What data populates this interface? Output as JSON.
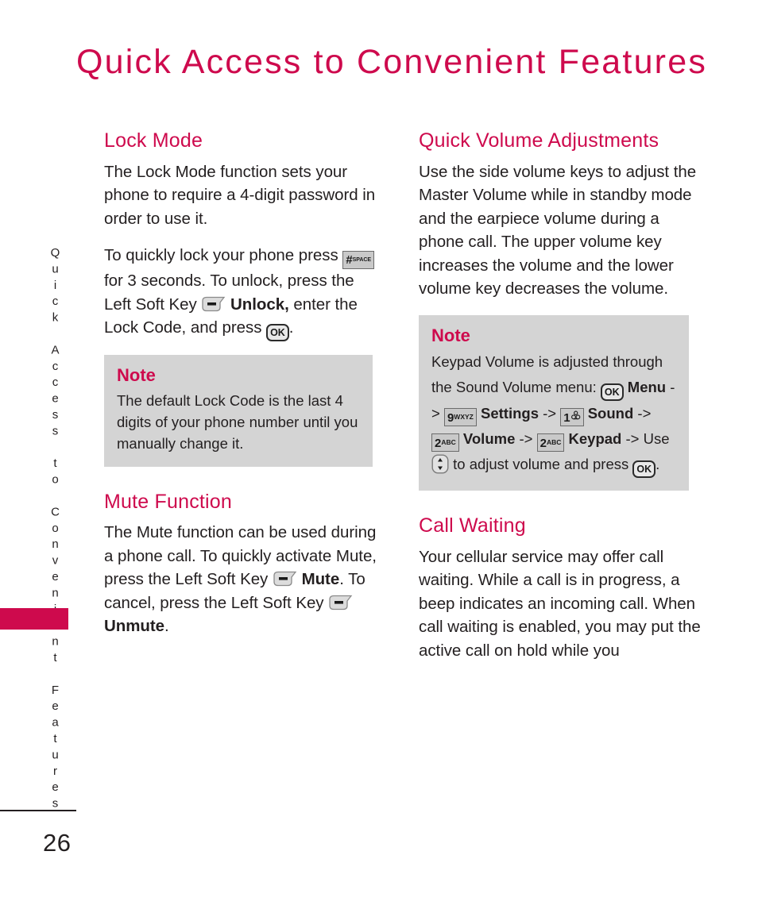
{
  "page": {
    "title": "Quick Access to Convenient Features",
    "side_tab_label": "Quick Access to Convenient Features",
    "number": "26",
    "accent_color": "#ce0a4d",
    "text_color": "#231f20",
    "note_bg_color": "#d4d4d4"
  },
  "left_column": {
    "lock_mode": {
      "heading": "Lock Mode",
      "paragraph_1": "The Lock Mode function sets your phone to require a 4-digit password in order to use it.",
      "paragraph_2": {
        "part_1": "To quickly lock your phone press",
        "key_1": "#-space-key",
        "part_2": "for 3 seconds. To unlock, press the Left Soft Key",
        "key_2": "left-soft-key",
        "part_3_bold": "Unlock,",
        "part_4": "enter the Lock Code, and press",
        "key_3": "ok-key",
        "part_5": "."
      },
      "note": {
        "title": "Note",
        "body": "The default Lock Code is the last 4 digits of your phone number until you manually change it."
      }
    },
    "mute_function": {
      "heading": "Mute Function",
      "paragraph": {
        "part_1": "The Mute function can be used during a phone call. To quickly activate Mute, press the Left Soft Key",
        "key_1": "left-soft-key",
        "part_2_bold": "Mute",
        "part_3": ". To cancel, press the Left Soft Key",
        "key_2": "left-soft-key",
        "part_4_bold": "Unmute",
        "part_5": "."
      }
    }
  },
  "right_column": {
    "quick_volume": {
      "heading": "Quick Volume Adjustments",
      "paragraph": "Use the side volume keys to adjust the Master Volume while in standby mode and the earpiece volume during a phone call. The upper volume key increases the volume and the lower volume key decreases the volume.",
      "note": {
        "title": "Note",
        "line_1": "Keypad Volume is adjusted through the Sound Volume menu:",
        "steps": [
          {
            "key": "ok-key",
            "key_label": "OK",
            "label": "Menu",
            "arrow": "->"
          },
          {
            "key": "9-wxyz-key",
            "key_num": "9",
            "key_sub": "WXYZ",
            "label": "Settings",
            "arrow": "->"
          },
          {
            "key": "1-voicemail-key",
            "key_num": "1",
            "label": "Sound",
            "arrow": "->"
          },
          {
            "key": "2-abc-key",
            "key_num": "2",
            "key_sub": "ABC",
            "label": "Volume",
            "arrow": "->"
          },
          {
            "key": "2-abc-key",
            "key_num": "2",
            "key_sub": "ABC",
            "label": "Keypad",
            "arrow": "->"
          }
        ],
        "tail_1": "Use",
        "tail_nav_key": "nav-up-down-key",
        "tail_2": "to adjust volume and press",
        "tail_ok_key": "OK",
        "tail_3": "."
      }
    },
    "call_waiting": {
      "heading": "Call Waiting",
      "paragraph": "Your cellular service may offer call waiting. While a call is in progress, a beep indicates an incoming call. When call waiting is enabled, you may put the active call on hold while you"
    }
  }
}
